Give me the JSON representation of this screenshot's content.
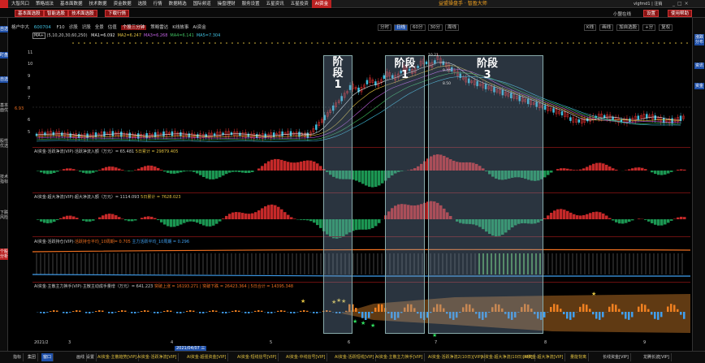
{
  "menu": {
    "items": [
      "大智风口",
      "策略战法",
      "基本面数据",
      "技术数据",
      "资金数据",
      "选股",
      "行情",
      "数据精选",
      "国际频道",
      "操盘理财",
      "服务设置",
      "五星资讯",
      "五星投资",
      "AI资金"
    ],
    "active_index": 13,
    "app_title": "益盟操盘手 · 智盈大师",
    "user": "vlgfmd1 | 注销"
  },
  "toolbar": {
    "buttons": [
      "基本面选股",
      "智能选股",
      "技术面选股",
      "下载行情"
    ],
    "right_buttons": [
      "设置",
      "使用帮助"
    ],
    "user_label": "小盟在线"
  },
  "left_tabs": [
    "自选",
    "盯盘",
    "自选",
    "基本面优",
    "股性优选",
    "技术指标",
    "下跌风险",
    "个股分析"
  ],
  "right_tabs": [
    "涨跌分布",
    "资讯",
    "资金"
  ],
  "info": {
    "stock": "格户中大",
    "code": "600704",
    "items": [
      "F10",
      "诊股",
      "识股",
      "全景",
      "估值",
      "个股三分钟",
      "策略雷达",
      "K线故事",
      "AI资金"
    ],
    "active_item": "个股三分钟",
    "periods": [
      "分时",
      "日线",
      "60分",
      "30分",
      "周线"
    ],
    "active_period": "日线",
    "right_items": [
      "K线",
      "画线",
      "加自选股",
      "+分",
      "复权"
    ]
  },
  "ma": {
    "label": "MA+",
    "params": "(5,10,20,30,60,250)",
    "values": [
      "MA1=6.092",
      "MA2=6.247",
      "MA3=6.268",
      "MA4=6.141",
      "MA5=7.304"
    ],
    "colors": [
      "#e8e8e8",
      "#e0c040",
      "#c060e0",
      "#40c060",
      "#40c0e0"
    ]
  },
  "yaxis": [
    "11",
    "10",
    "9",
    "8",
    "7",
    "6.93",
    "6",
    "5"
  ],
  "price_labels": [
    "10.21",
    "9.44",
    "8.50",
    "5.48"
  ],
  "panels": [
    {
      "title": "AI资金·活跃净流(VIP)·",
      "desc": "活跃净流入额（万元）",
      "v1": "= 65.481",
      "v2": "5日累计 = 29879.405"
    },
    {
      "title": "AI资金·超大净流(VIP)·",
      "desc": "超大净流入额（万元）",
      "v1": "= 1114.093",
      "v2": "5日累计 = 7628.023"
    },
    {
      "title": "AI资金·活跃持仓(VIP)·",
      "desc": "活跃持仓平均_10周期",
      "v1": "= 0.705",
      "v2": "主力活跃平均_10周期 = 0.296"
    },
    {
      "title": "AI资金·主散主力换手(VIP)·",
      "desc": "主散主动成手量增（万元）",
      "v1": "= 641.223",
      "v2": "突破上涨 = 16193.271 | 突破下跌 = 26423.364 | 5日合计 = 14395.348"
    }
  ],
  "stages": [
    {
      "line1": "阶",
      "line2": "段",
      "line3": "1"
    },
    {
      "line1": "阶段",
      "line2": "1",
      "line3": ""
    },
    {
      "line1": "阶段",
      "line2": "3",
      "line3": ""
    }
  ],
  "time_labels": [
    "2021/2",
    "3",
    "4",
    "5",
    "6",
    "7",
    "8",
    "9"
  ],
  "time_badge": "2021/04/07 三",
  "tabs": [
    "指标",
    "集团",
    "窗口",
    "画线",
    "设置",
    "AI资金·主散趋势[VIP]",
    "AI资金·活跃净流[VIP]",
    "AI资金·超强资金[VIP]",
    "AI资金·短线信号[VIP]",
    "AI资金·中线信号[VIP]",
    "AI资金·活跃短线[VIP]",
    "AI资金·主散主力换手[VIP]",
    "AI资金·活跃净流2(10日)[VIP]",
    "AI资金·超大净流(10日)[VIP]",
    "AI资金·超大净流[VIP]",
    "量能背离",
    "长线资金[VIP]",
    "龙腾长波[VIP]"
  ],
  "colors": {
    "up": "#e83030",
    "down": "#20b060",
    "stage": "#7896b4",
    "accent": "#1e4fa8",
    "gold": "#e0c040"
  }
}
